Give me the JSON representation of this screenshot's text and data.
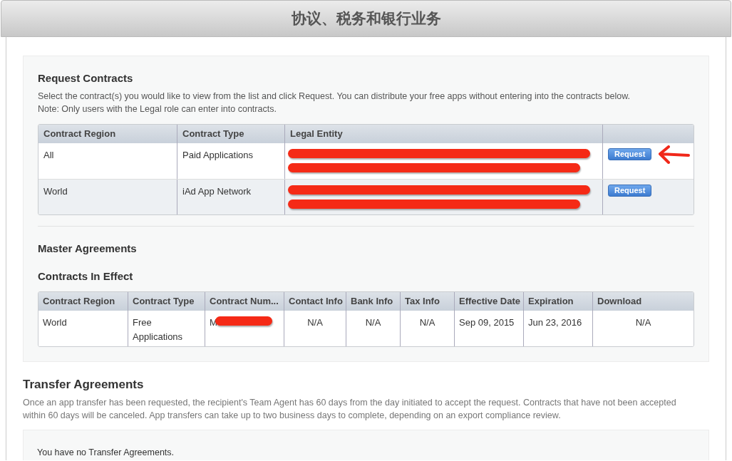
{
  "window": {
    "title": "协议、税务和银行业务"
  },
  "request_contracts": {
    "title": "Request Contracts",
    "description": "Select the contract(s) you would like to view from the list and click Request. You can distribute your free apps without entering into the contracts below.",
    "note": "Note: Only users with the Legal role can enter into contracts.",
    "columns": [
      "Contract Region",
      "Contract Type",
      "Legal Entity"
    ],
    "rows": [
      {
        "region": "All",
        "type": "Paid Applications",
        "legal_entity_redacted": true,
        "button": "Request",
        "arrow_marked": true
      },
      {
        "region": "World",
        "type": "iAd App Network",
        "legal_entity_redacted": true,
        "button": "Request",
        "arrow_marked": false
      }
    ]
  },
  "master_agreements": {
    "title": "Master Agreements"
  },
  "contracts_in_effect": {
    "title": "Contracts In Effect",
    "columns": [
      "Contract Region",
      "Contract Type",
      "Contract Num...",
      "Contact Info",
      "Bank Info",
      "Tax Info",
      "Effective Date",
      "Expiration",
      "Download"
    ],
    "rows": [
      {
        "region": "World",
        "type": "Free Applications",
        "number": "M",
        "number_redacted": true,
        "contact_info": "N/A",
        "bank_info": "N/A",
        "tax_info": "N/A",
        "effective_date": "Sep 09, 2015",
        "expiration": "Jun 23, 2016",
        "download": "N/A"
      }
    ]
  },
  "transfer_agreements": {
    "title": "Transfer Agreements",
    "description": "Once an app transfer has been requested, the recipient's Team Agent has 60 days from the day initiated to accept the request. Contracts that have not been accepted within 60 days will be canceled. App transfers can take up to two business days to complete, depending on an export compliance review.",
    "empty_message": "You have no Transfer Agreements."
  }
}
